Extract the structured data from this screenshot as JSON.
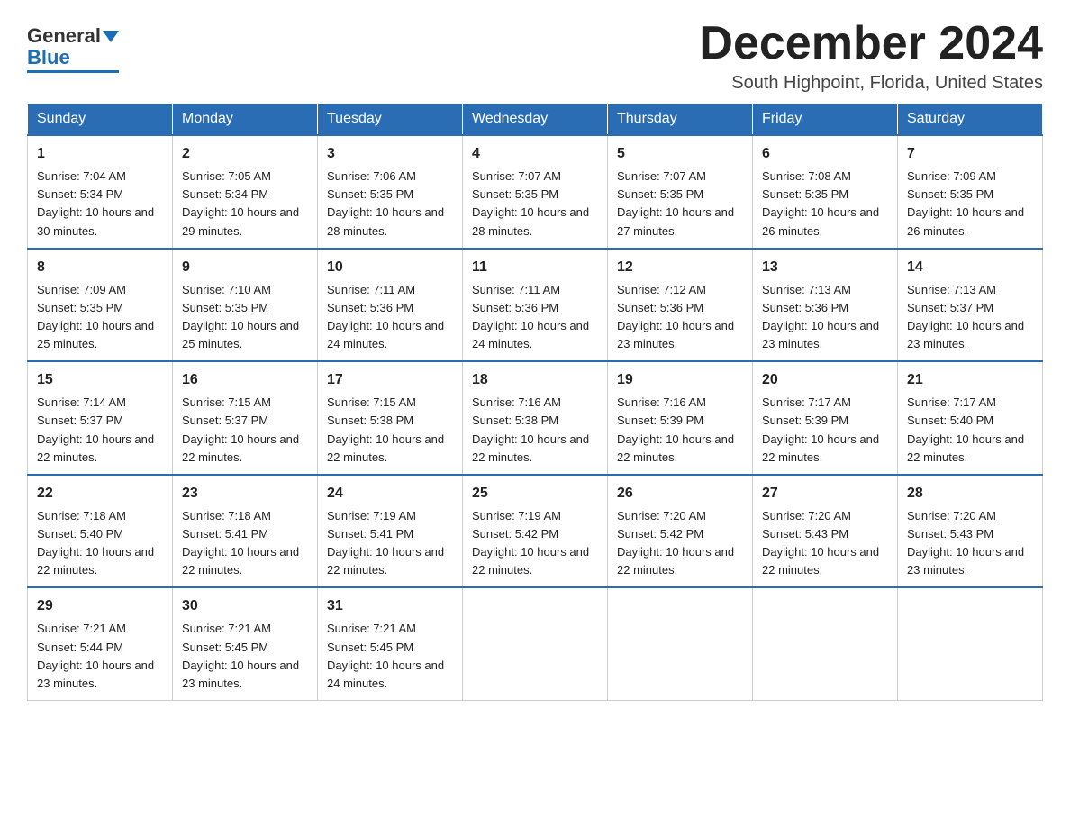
{
  "header": {
    "logo_text_general": "General",
    "logo_text_blue": "Blue",
    "month_title": "December 2024",
    "subtitle": "South Highpoint, Florida, United States"
  },
  "weekdays": [
    "Sunday",
    "Monday",
    "Tuesday",
    "Wednesday",
    "Thursday",
    "Friday",
    "Saturday"
  ],
  "weeks": [
    [
      {
        "day": "1",
        "sunrise": "7:04 AM",
        "sunset": "5:34 PM",
        "daylight": "10 hours and 30 minutes."
      },
      {
        "day": "2",
        "sunrise": "7:05 AM",
        "sunset": "5:34 PM",
        "daylight": "10 hours and 29 minutes."
      },
      {
        "day": "3",
        "sunrise": "7:06 AM",
        "sunset": "5:35 PM",
        "daylight": "10 hours and 28 minutes."
      },
      {
        "day": "4",
        "sunrise": "7:07 AM",
        "sunset": "5:35 PM",
        "daylight": "10 hours and 28 minutes."
      },
      {
        "day": "5",
        "sunrise": "7:07 AM",
        "sunset": "5:35 PM",
        "daylight": "10 hours and 27 minutes."
      },
      {
        "day": "6",
        "sunrise": "7:08 AM",
        "sunset": "5:35 PM",
        "daylight": "10 hours and 26 minutes."
      },
      {
        "day": "7",
        "sunrise": "7:09 AM",
        "sunset": "5:35 PM",
        "daylight": "10 hours and 26 minutes."
      }
    ],
    [
      {
        "day": "8",
        "sunrise": "7:09 AM",
        "sunset": "5:35 PM",
        "daylight": "10 hours and 25 minutes."
      },
      {
        "day": "9",
        "sunrise": "7:10 AM",
        "sunset": "5:35 PM",
        "daylight": "10 hours and 25 minutes."
      },
      {
        "day": "10",
        "sunrise": "7:11 AM",
        "sunset": "5:36 PM",
        "daylight": "10 hours and 24 minutes."
      },
      {
        "day": "11",
        "sunrise": "7:11 AM",
        "sunset": "5:36 PM",
        "daylight": "10 hours and 24 minutes."
      },
      {
        "day": "12",
        "sunrise": "7:12 AM",
        "sunset": "5:36 PM",
        "daylight": "10 hours and 23 minutes."
      },
      {
        "day": "13",
        "sunrise": "7:13 AM",
        "sunset": "5:36 PM",
        "daylight": "10 hours and 23 minutes."
      },
      {
        "day": "14",
        "sunrise": "7:13 AM",
        "sunset": "5:37 PM",
        "daylight": "10 hours and 23 minutes."
      }
    ],
    [
      {
        "day": "15",
        "sunrise": "7:14 AM",
        "sunset": "5:37 PM",
        "daylight": "10 hours and 22 minutes."
      },
      {
        "day": "16",
        "sunrise": "7:15 AM",
        "sunset": "5:37 PM",
        "daylight": "10 hours and 22 minutes."
      },
      {
        "day": "17",
        "sunrise": "7:15 AM",
        "sunset": "5:38 PM",
        "daylight": "10 hours and 22 minutes."
      },
      {
        "day": "18",
        "sunrise": "7:16 AM",
        "sunset": "5:38 PM",
        "daylight": "10 hours and 22 minutes."
      },
      {
        "day": "19",
        "sunrise": "7:16 AM",
        "sunset": "5:39 PM",
        "daylight": "10 hours and 22 minutes."
      },
      {
        "day": "20",
        "sunrise": "7:17 AM",
        "sunset": "5:39 PM",
        "daylight": "10 hours and 22 minutes."
      },
      {
        "day": "21",
        "sunrise": "7:17 AM",
        "sunset": "5:40 PM",
        "daylight": "10 hours and 22 minutes."
      }
    ],
    [
      {
        "day": "22",
        "sunrise": "7:18 AM",
        "sunset": "5:40 PM",
        "daylight": "10 hours and 22 minutes."
      },
      {
        "day": "23",
        "sunrise": "7:18 AM",
        "sunset": "5:41 PM",
        "daylight": "10 hours and 22 minutes."
      },
      {
        "day": "24",
        "sunrise": "7:19 AM",
        "sunset": "5:41 PM",
        "daylight": "10 hours and 22 minutes."
      },
      {
        "day": "25",
        "sunrise": "7:19 AM",
        "sunset": "5:42 PM",
        "daylight": "10 hours and 22 minutes."
      },
      {
        "day": "26",
        "sunrise": "7:20 AM",
        "sunset": "5:42 PM",
        "daylight": "10 hours and 22 minutes."
      },
      {
        "day": "27",
        "sunrise": "7:20 AM",
        "sunset": "5:43 PM",
        "daylight": "10 hours and 22 minutes."
      },
      {
        "day": "28",
        "sunrise": "7:20 AM",
        "sunset": "5:43 PM",
        "daylight": "10 hours and 23 minutes."
      }
    ],
    [
      {
        "day": "29",
        "sunrise": "7:21 AM",
        "sunset": "5:44 PM",
        "daylight": "10 hours and 23 minutes."
      },
      {
        "day": "30",
        "sunrise": "7:21 AM",
        "sunset": "5:45 PM",
        "daylight": "10 hours and 23 minutes."
      },
      {
        "day": "31",
        "sunrise": "7:21 AM",
        "sunset": "5:45 PM",
        "daylight": "10 hours and 24 minutes."
      },
      null,
      null,
      null,
      null
    ]
  ]
}
